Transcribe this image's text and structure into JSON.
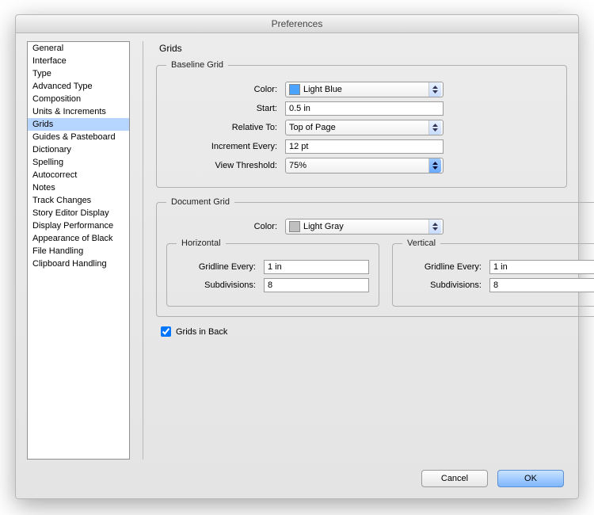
{
  "title": "Preferences",
  "sidebar": {
    "items": [
      {
        "label": "General"
      },
      {
        "label": "Interface"
      },
      {
        "label": "Type"
      },
      {
        "label": "Advanced Type"
      },
      {
        "label": "Composition"
      },
      {
        "label": "Units & Increments"
      },
      {
        "label": "Grids",
        "selected": true
      },
      {
        "label": "Guides & Pasteboard"
      },
      {
        "label": "Dictionary"
      },
      {
        "label": "Spelling"
      },
      {
        "label": "Autocorrect"
      },
      {
        "label": "Notes"
      },
      {
        "label": "Track Changes"
      },
      {
        "label": "Story Editor Display"
      },
      {
        "label": "Display Performance"
      },
      {
        "label": "Appearance of Black"
      },
      {
        "label": "File Handling"
      },
      {
        "label": "Clipboard Handling"
      }
    ]
  },
  "panel": {
    "title": "Grids",
    "baseline": {
      "legend": "Baseline Grid",
      "color_label": "Color:",
      "color_value": "Light Blue",
      "color_hex": "#4aa3ff",
      "start_label": "Start:",
      "start_value": "0.5 in",
      "relative_label": "Relative To:",
      "relative_value": "Top of Page",
      "increment_label": "Increment Every:",
      "increment_value": "12 pt",
      "threshold_label": "View Threshold:",
      "threshold_value": "75%"
    },
    "document": {
      "legend": "Document Grid",
      "color_label": "Color:",
      "color_value": "Light Gray",
      "color_hex": "#bfbfbf",
      "horizontal": {
        "legend": "Horizontal",
        "gridline_label": "Gridline Every:",
        "gridline_value": "1 in",
        "subdiv_label": "Subdivisions:",
        "subdiv_value": "8"
      },
      "vertical": {
        "legend": "Vertical",
        "gridline_label": "Gridline Every:",
        "gridline_value": "1 in",
        "subdiv_label": "Subdivisions:",
        "subdiv_value": "8"
      }
    },
    "grids_in_back": {
      "label": "Grids in Back",
      "checked": true
    }
  },
  "buttons": {
    "cancel": "Cancel",
    "ok": "OK"
  }
}
